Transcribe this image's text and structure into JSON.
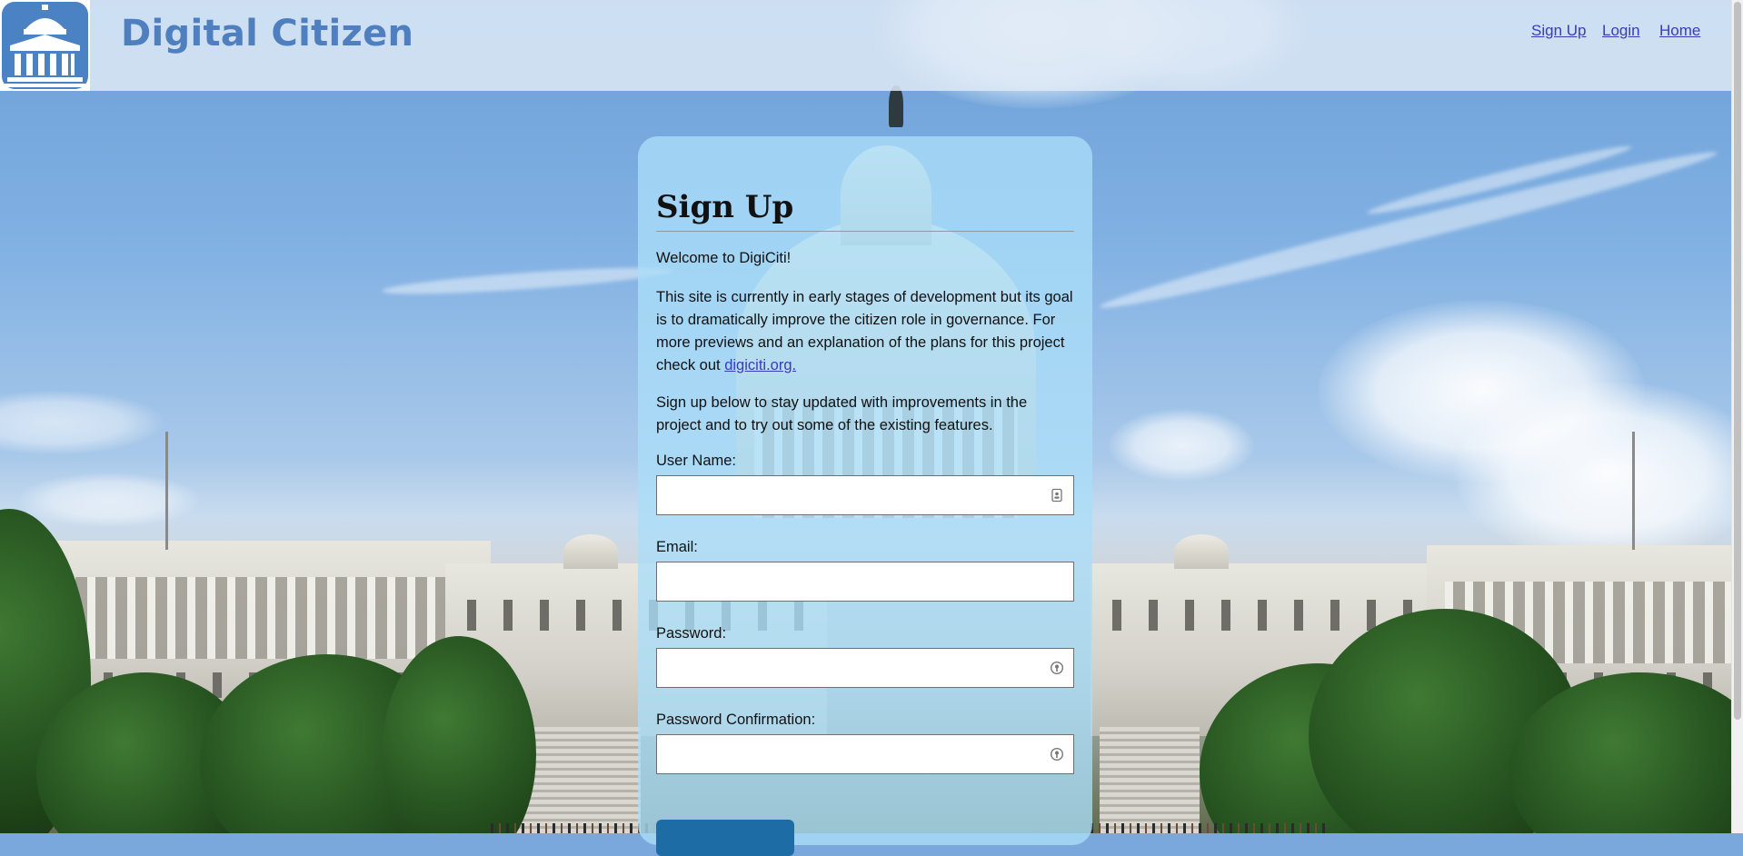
{
  "header": {
    "brand": "Digital Citizen",
    "logo_icon": "capitol-building-icon",
    "nav": [
      "Sign Up",
      "Login",
      "Home"
    ]
  },
  "signup": {
    "title": "Sign Up",
    "welcome": "Welcome to DigiCiti!",
    "intro_text": "This site is currently in early stages of development but its goal is to dramatically improve the citizen role in governance. For more previews and an explanation of the plans for this project check out",
    "intro_link": "digiciti.org.",
    "cta_text": "Sign up below to stay updated with improvements in the project and to try out some of the existing features.",
    "fields": [
      {
        "label": "User Name:",
        "value": "",
        "icon": "contact-card-icon"
      },
      {
        "label": "Email:",
        "value": ""
      },
      {
        "label": "Password:",
        "value": "",
        "icon": "password-key-icon"
      },
      {
        "label": "Password Confirmation:",
        "value": "",
        "icon": "password-key-icon"
      }
    ]
  },
  "colors": {
    "brand_blue": "#4f7fbe",
    "link": "#3a3bb8",
    "card_bg": "#abdef8",
    "button": "#1e6ca6"
  }
}
